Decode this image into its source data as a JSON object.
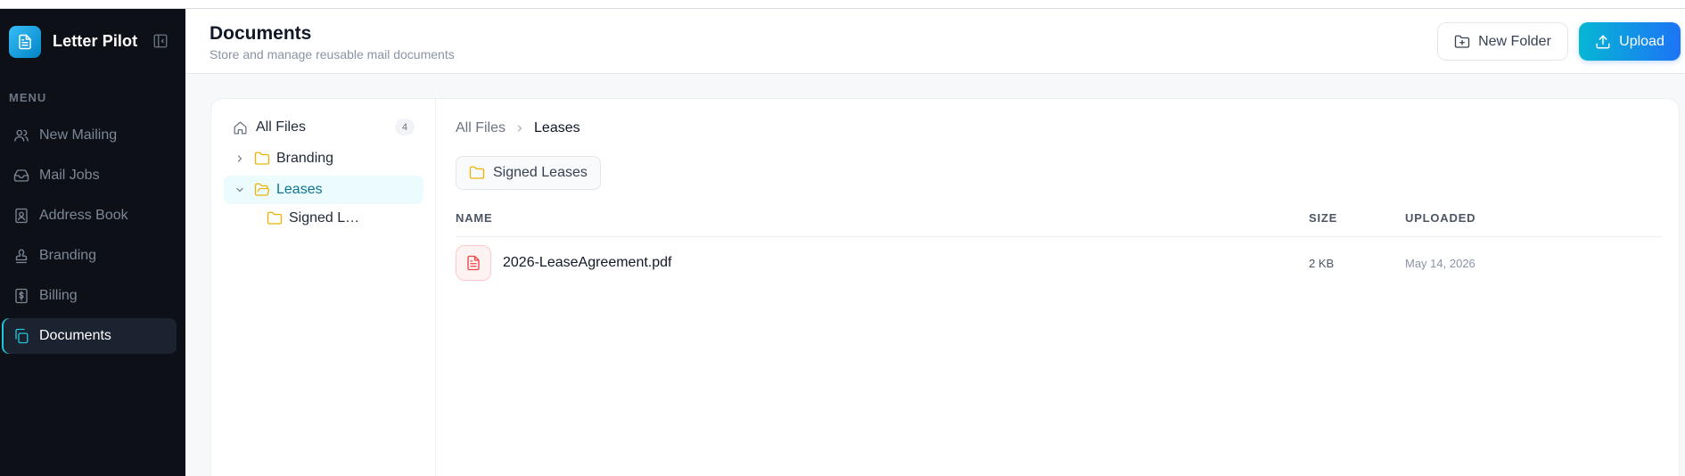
{
  "app": {
    "name": "Letter Pilot"
  },
  "sidebar": {
    "menu_heading": "MENU",
    "items": [
      {
        "label": "New Mailing",
        "icon": "users-icon"
      },
      {
        "label": "Mail Jobs",
        "icon": "inbox-icon"
      },
      {
        "label": "Address Book",
        "icon": "contact-book-icon"
      },
      {
        "label": "Branding",
        "icon": "stamp-icon"
      },
      {
        "label": "Billing",
        "icon": "dollar-receipt-icon"
      },
      {
        "label": "Documents",
        "icon": "documents-icon",
        "active": true
      }
    ]
  },
  "header": {
    "title": "Documents",
    "subtitle": "Store and manage reusable mail documents",
    "new_folder_label": "New Folder",
    "upload_label": "Upload"
  },
  "tree": {
    "all_files_label": "All Files",
    "all_files_count": "4",
    "folders": [
      {
        "label": "Branding",
        "expanded": false
      },
      {
        "label": "Leases",
        "expanded": true,
        "selected": true
      }
    ],
    "subfolder_label": "Signed L…"
  },
  "content": {
    "breadcrumb": {
      "root": "All Files",
      "current": "Leases"
    },
    "subfolder_chip": "Signed Leases",
    "columns": {
      "name": "NAME",
      "size": "SIZE",
      "uploaded": "UPLOADED"
    },
    "files": [
      {
        "name": "2026-LeaseAgreement.pdf",
        "size": "2 KB",
        "uploaded": "May 14, 2026"
      }
    ]
  },
  "colors": {
    "accent": "#06b6d4",
    "upload_gradient_end": "#1d74f5",
    "folder": "#eab308",
    "pdf": "#ef4444",
    "sidebar_bg": "#0d1117"
  }
}
